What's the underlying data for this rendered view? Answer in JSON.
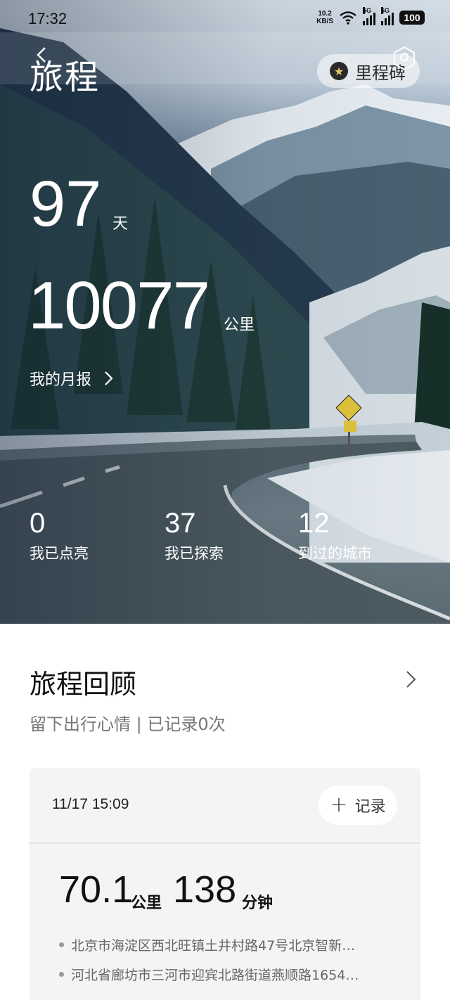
{
  "status_bar": {
    "time": "17:32",
    "net_speed_value": "10.2",
    "net_speed_unit": "KB/S",
    "signal1_label": "5G",
    "signal2_label": "5G",
    "battery": "100"
  },
  "header": {
    "title": "旅程",
    "milestone_label": "里程碑"
  },
  "stats": {
    "days_value": "97",
    "days_unit": "天",
    "distance_value": "10077",
    "distance_unit": "公里",
    "monthly_report_label": "我的月报",
    "lit": {
      "value": "0",
      "label": "我已点亮"
    },
    "explored": {
      "value": "37",
      "label": "我已探索"
    },
    "cities": {
      "value": "12",
      "label": "到过的城市"
    }
  },
  "review": {
    "title": "旅程回顾",
    "subtitle": "留下出行心情 | 已记录0次"
  },
  "trip": {
    "time": "11/17 15:09",
    "record_label": "记录",
    "distance_value": "70.1",
    "distance_unit": "公里",
    "duration_value": "138",
    "duration_unit": "分钟",
    "start_address": "北京市海淀区西北旺镇土井村路47号北京智新…",
    "end_address": "河北省廊坊市三河市迎宾北路街道燕顺路1654…"
  },
  "icons": {
    "back": "back-arrow-icon",
    "share": "share-icon",
    "star": "star-icon",
    "chevron": "chevron-right-icon",
    "plus": "plus-icon",
    "wifi": "wifi-icon"
  },
  "colors": {
    "hero_text": "#ffffff",
    "star_gold": "#e9c66b",
    "card_bg": "#f4f4f5"
  }
}
